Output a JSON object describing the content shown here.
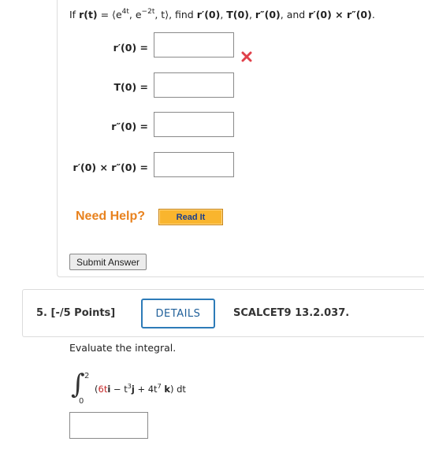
{
  "question4": {
    "prompt": {
      "if": "If ",
      "r_t": "r(t)",
      "eq_open": " = ⟨e",
      "exp1": "4t",
      "mid1": ", e",
      "exp2": "−2t",
      "mid2": ", t⟩, find ",
      "r_prime_0": "r′(0)",
      "sep1": ", ",
      "T_0": "T(0)",
      "sep2": ", ",
      "r_dprime_0": "r″(0)",
      "and": ", and ",
      "cross": "r′(0) × r″(0)",
      "end": "."
    },
    "rows": [
      {
        "label": "r′(0)  =",
        "value": "",
        "status": "incorrect"
      },
      {
        "label": "T(0)  =",
        "value": ""
      },
      {
        "label": "r″(0)  =",
        "value": ""
      },
      {
        "label": "r′(0) × r″(0)  =",
        "value": ""
      }
    ],
    "need_help": "Need Help?",
    "read_it": "Read It",
    "submit": "Submit Answer"
  },
  "question5": {
    "title": "5.  [-/5 Points]",
    "details": "DETAILS",
    "course_code": "SCALCET9 13.2.037.",
    "instruction": "Evaluate the integral.",
    "integral": {
      "upper": "2",
      "lower": "0",
      "open": "(",
      "t6": "6t",
      "i": "i",
      "minus": " − t",
      "exp3": "3",
      "j": "j",
      "plus": " + 4t",
      "exp7": "7",
      "k": "k",
      "close": ") dt"
    },
    "answer_value": ""
  },
  "colors": {
    "incorrect": "#e0404a",
    "need_help": "#e8821e",
    "read_it_bg": "#f9b52e",
    "details_border": "#2d7bb8"
  }
}
